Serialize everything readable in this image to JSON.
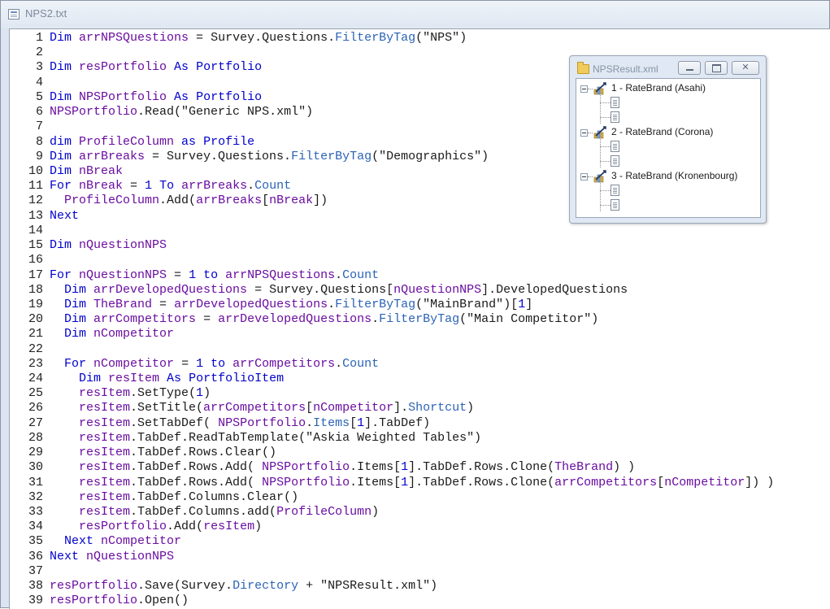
{
  "main_window": {
    "title": "NPS2.txt",
    "icon": "text-file-icon"
  },
  "code_lines": [
    {
      "n": "1",
      "parts": [
        [
          "kw",
          "Dim "
        ],
        [
          "id",
          "arrNPSQuestions"
        ],
        [
          "tx",
          " = "
        ],
        [
          "tx",
          "Survey"
        ],
        [
          "tx",
          "."
        ],
        [
          "tx",
          "Questions"
        ],
        [
          "tx",
          "."
        ],
        [
          "pr",
          "FilterByTag"
        ],
        [
          "tx",
          "("
        ],
        [
          "st",
          "\"NPS\""
        ],
        [
          "tx",
          ")"
        ]
      ]
    },
    {
      "n": "2",
      "parts": []
    },
    {
      "n": "3",
      "parts": [
        [
          "kw",
          "Dim "
        ],
        [
          "id",
          "resPortfolio"
        ],
        [
          "kw",
          " As "
        ],
        [
          "kw",
          "Portfolio"
        ]
      ]
    },
    {
      "n": "4",
      "parts": []
    },
    {
      "n": "5",
      "parts": [
        [
          "kw",
          "Dim "
        ],
        [
          "id",
          "NPSPortfolio"
        ],
        [
          "kw",
          " As "
        ],
        [
          "kw",
          "Portfolio"
        ]
      ]
    },
    {
      "n": "6",
      "parts": [
        [
          "id",
          "NPSPortfolio"
        ],
        [
          "tx",
          ".Read("
        ],
        [
          "st",
          "\"Generic NPS.xml\""
        ],
        [
          "tx",
          ")"
        ]
      ]
    },
    {
      "n": "7",
      "parts": []
    },
    {
      "n": "8",
      "parts": [
        [
          "kw",
          "dim "
        ],
        [
          "id",
          "ProfileColumn"
        ],
        [
          "kw",
          " as "
        ],
        [
          "kw",
          "Profile"
        ]
      ]
    },
    {
      "n": "9",
      "parts": [
        [
          "kw",
          "Dim "
        ],
        [
          "id",
          "arrBreaks"
        ],
        [
          "tx",
          " = Survey.Questions."
        ],
        [
          "pr",
          "FilterByTag"
        ],
        [
          "tx",
          "("
        ],
        [
          "st",
          "\"Demographics\""
        ],
        [
          "tx",
          ")"
        ]
      ]
    },
    {
      "n": "10",
      "parts": [
        [
          "kw",
          "Dim "
        ],
        [
          "id",
          "nBreak"
        ]
      ]
    },
    {
      "n": "11",
      "parts": [
        [
          "kw",
          "For "
        ],
        [
          "id",
          "nBreak"
        ],
        [
          "tx",
          " = "
        ],
        [
          "kw",
          "1"
        ],
        [
          "kw",
          " To "
        ],
        [
          "id",
          "arrBreaks"
        ],
        [
          "tx",
          "."
        ],
        [
          "pr",
          "Count"
        ]
      ]
    },
    {
      "n": "12",
      "parts": [
        [
          "tx",
          "  "
        ],
        [
          "id",
          "ProfileColumn"
        ],
        [
          "tx",
          ".Add("
        ],
        [
          "id",
          "arrBreaks"
        ],
        [
          "tx",
          "["
        ],
        [
          "id",
          "nBreak"
        ],
        [
          "tx",
          "])"
        ]
      ]
    },
    {
      "n": "13",
      "parts": [
        [
          "kw",
          "Next"
        ]
      ]
    },
    {
      "n": "14",
      "parts": []
    },
    {
      "n": "15",
      "parts": [
        [
          "kw",
          "Dim "
        ],
        [
          "id",
          "nQuestionNPS"
        ]
      ]
    },
    {
      "n": "16",
      "parts": []
    },
    {
      "n": "17",
      "parts": [
        [
          "kw",
          "For "
        ],
        [
          "id",
          "nQuestionNPS"
        ],
        [
          "tx",
          " = "
        ],
        [
          "kw",
          "1"
        ],
        [
          "kw",
          " to "
        ],
        [
          "id",
          "arrNPSQuestions"
        ],
        [
          "tx",
          "."
        ],
        [
          "pr",
          "Count"
        ]
      ]
    },
    {
      "n": "18",
      "parts": [
        [
          "tx",
          "  "
        ],
        [
          "kw",
          "Dim "
        ],
        [
          "id",
          "arrDevelopedQuestions"
        ],
        [
          "tx",
          " = Survey.Questions["
        ],
        [
          "id",
          "nQuestionNPS"
        ],
        [
          "tx",
          "].DevelopedQuestions"
        ]
      ]
    },
    {
      "n": "19",
      "parts": [
        [
          "tx",
          "  "
        ],
        [
          "kw",
          "Dim "
        ],
        [
          "id",
          "TheBrand"
        ],
        [
          "tx",
          " = "
        ],
        [
          "id",
          "arrDevelopedQuestions"
        ],
        [
          "tx",
          "."
        ],
        [
          "pr",
          "FilterByTag"
        ],
        [
          "tx",
          "("
        ],
        [
          "st",
          "\"MainBrand\""
        ],
        [
          "tx",
          ")["
        ],
        [
          "kw",
          "1"
        ],
        [
          "tx",
          "]"
        ]
      ]
    },
    {
      "n": "20",
      "parts": [
        [
          "tx",
          "  "
        ],
        [
          "kw",
          "Dim "
        ],
        [
          "id",
          "arrCompetitors"
        ],
        [
          "tx",
          " = "
        ],
        [
          "id",
          "arrDevelopedQuestions"
        ],
        [
          "tx",
          "."
        ],
        [
          "pr",
          "FilterByTag"
        ],
        [
          "tx",
          "("
        ],
        [
          "st",
          "\"Main Competitor\""
        ],
        [
          "tx",
          ")"
        ]
      ]
    },
    {
      "n": "21",
      "parts": [
        [
          "tx",
          "  "
        ],
        [
          "kw",
          "Dim "
        ],
        [
          "id",
          "nCompetitor"
        ]
      ]
    },
    {
      "n": "22",
      "parts": []
    },
    {
      "n": "23",
      "parts": [
        [
          "tx",
          "  "
        ],
        [
          "kw",
          "For "
        ],
        [
          "id",
          "nCompetitor"
        ],
        [
          "tx",
          " = "
        ],
        [
          "kw",
          "1"
        ],
        [
          "kw",
          " to "
        ],
        [
          "id",
          "arrCompetitors"
        ],
        [
          "tx",
          "."
        ],
        [
          "pr",
          "Count"
        ]
      ]
    },
    {
      "n": "24",
      "parts": [
        [
          "tx",
          "    "
        ],
        [
          "kw",
          "Dim "
        ],
        [
          "id",
          "resItem"
        ],
        [
          "kw",
          " As "
        ],
        [
          "kw",
          "PortfolioItem"
        ]
      ]
    },
    {
      "n": "25",
      "parts": [
        [
          "tx",
          "    "
        ],
        [
          "id",
          "resItem"
        ],
        [
          "tx",
          ".SetType("
        ],
        [
          "kw",
          "1"
        ],
        [
          "tx",
          ")"
        ]
      ]
    },
    {
      "n": "26",
      "parts": [
        [
          "tx",
          "    "
        ],
        [
          "id",
          "resItem"
        ],
        [
          "tx",
          ".SetTitle("
        ],
        [
          "id",
          "arrCompetitors"
        ],
        [
          "tx",
          "["
        ],
        [
          "id",
          "nCompetitor"
        ],
        [
          "tx",
          "]."
        ],
        [
          "pr",
          "Shortcut"
        ],
        [
          "tx",
          ")"
        ]
      ]
    },
    {
      "n": "27",
      "parts": [
        [
          "tx",
          "    "
        ],
        [
          "id",
          "resItem"
        ],
        [
          "tx",
          ".SetTabDef( "
        ],
        [
          "id",
          "NPSPortfolio"
        ],
        [
          "tx",
          "."
        ],
        [
          "pr",
          "Items"
        ],
        [
          "tx",
          "["
        ],
        [
          "kw",
          "1"
        ],
        [
          "tx",
          "].TabDef)"
        ]
      ]
    },
    {
      "n": "28",
      "parts": [
        [
          "tx",
          "    "
        ],
        [
          "id",
          "resItem"
        ],
        [
          "tx",
          ".TabDef.ReadTabTemplate("
        ],
        [
          "st",
          "\"Askia Weighted Tables\""
        ],
        [
          "tx",
          ")"
        ]
      ]
    },
    {
      "n": "29",
      "parts": [
        [
          "tx",
          "    "
        ],
        [
          "id",
          "resItem"
        ],
        [
          "tx",
          ".TabDef.Rows.Clear()"
        ]
      ]
    },
    {
      "n": "30",
      "parts": [
        [
          "tx",
          "    "
        ],
        [
          "id",
          "resItem"
        ],
        [
          "tx",
          ".TabDef.Rows.Add( "
        ],
        [
          "id",
          "NPSPortfolio"
        ],
        [
          "tx",
          ".Items["
        ],
        [
          "kw",
          "1"
        ],
        [
          "tx",
          "].TabDef.Rows.Clone("
        ],
        [
          "id",
          "TheBrand"
        ],
        [
          "tx",
          ") )"
        ]
      ]
    },
    {
      "n": "31",
      "parts": [
        [
          "tx",
          "    "
        ],
        [
          "id",
          "resItem"
        ],
        [
          "tx",
          ".TabDef.Rows.Add( "
        ],
        [
          "id",
          "NPSPortfolio"
        ],
        [
          "tx",
          ".Items["
        ],
        [
          "kw",
          "1"
        ],
        [
          "tx",
          "].TabDef.Rows.Clone("
        ],
        [
          "id",
          "arrCompetitors"
        ],
        [
          "tx",
          "["
        ],
        [
          "id",
          "nCompetitor"
        ],
        [
          "tx",
          "]) )"
        ]
      ]
    },
    {
      "n": "32",
      "parts": [
        [
          "tx",
          "    "
        ],
        [
          "id",
          "resItem"
        ],
        [
          "tx",
          ".TabDef.Columns.Clear()"
        ]
      ]
    },
    {
      "n": "33",
      "parts": [
        [
          "tx",
          "    "
        ],
        [
          "id",
          "resItem"
        ],
        [
          "tx",
          ".TabDef.Columns.add("
        ],
        [
          "id",
          "ProfileColumn"
        ],
        [
          "tx",
          ")"
        ]
      ]
    },
    {
      "n": "34",
      "parts": [
        [
          "tx",
          "    "
        ],
        [
          "id",
          "resPortfolio"
        ],
        [
          "tx",
          ".Add("
        ],
        [
          "id",
          "resItem"
        ],
        [
          "tx",
          ")"
        ]
      ]
    },
    {
      "n": "35",
      "parts": [
        [
          "tx",
          "  "
        ],
        [
          "kw",
          "Next "
        ],
        [
          "id",
          "nCompetitor"
        ]
      ]
    },
    {
      "n": "36",
      "parts": [
        [
          "kw",
          "Next "
        ],
        [
          "id",
          "nQuestionNPS"
        ]
      ]
    },
    {
      "n": "37",
      "parts": []
    },
    {
      "n": "38",
      "parts": [
        [
          "id",
          "resPortfolio"
        ],
        [
          "tx",
          ".Save(Survey."
        ],
        [
          "pr",
          "Directory"
        ],
        [
          "tx",
          " + "
        ],
        [
          "st",
          "\"NPSResult.xml\""
        ],
        [
          "tx",
          ")"
        ]
      ]
    },
    {
      "n": "39",
      "parts": [
        [
          "id",
          "resPortfolio"
        ],
        [
          "tx",
          ".Open()"
        ]
      ]
    }
  ],
  "child_window": {
    "title": "NPSResult.xml",
    "icon": "folder-icon",
    "buttons": [
      "minimize",
      "maximize",
      "close"
    ]
  },
  "tree": {
    "nodes": [
      {
        "label": "1 - RateBrand (Asahi)",
        "icon": "rating-chart-icon",
        "children": [
          "document-icon",
          "document-icon"
        ]
      },
      {
        "label": "2 - RateBrand (Corona)",
        "icon": "rating-chart-icon",
        "children": [
          "document-icon",
          "document-icon"
        ]
      },
      {
        "label": "3 - RateBrand (Kronenbourg)",
        "icon": "rating-chart-icon",
        "children": [
          "document-icon",
          "document-icon"
        ]
      }
    ]
  },
  "colors": {
    "keyword": "#0000cc",
    "identifier": "#6a0da0",
    "property": "#2b63b5",
    "text": "#1a1a1a"
  }
}
